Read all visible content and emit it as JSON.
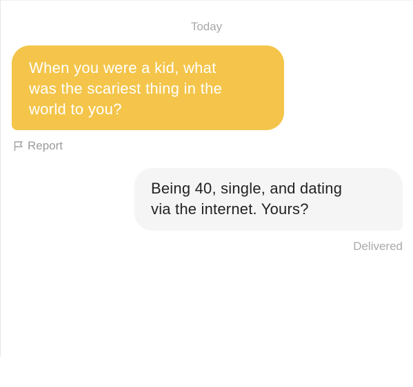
{
  "conversation": {
    "date_header": "Today",
    "incoming_message": {
      "text": "When you were a kid, what\nwas the scariest thing in the\nworld to you?",
      "bubble_color": "#f4c54a",
      "text_color": "#ffffff"
    },
    "report": {
      "label": "Report",
      "icon": "flag-icon"
    },
    "outgoing_message": {
      "text": "Being 40, single, and dating\nvia the internet. Yours?",
      "bubble_color": "#f5f5f6",
      "text_color": "#222222"
    },
    "status": "Delivered"
  }
}
